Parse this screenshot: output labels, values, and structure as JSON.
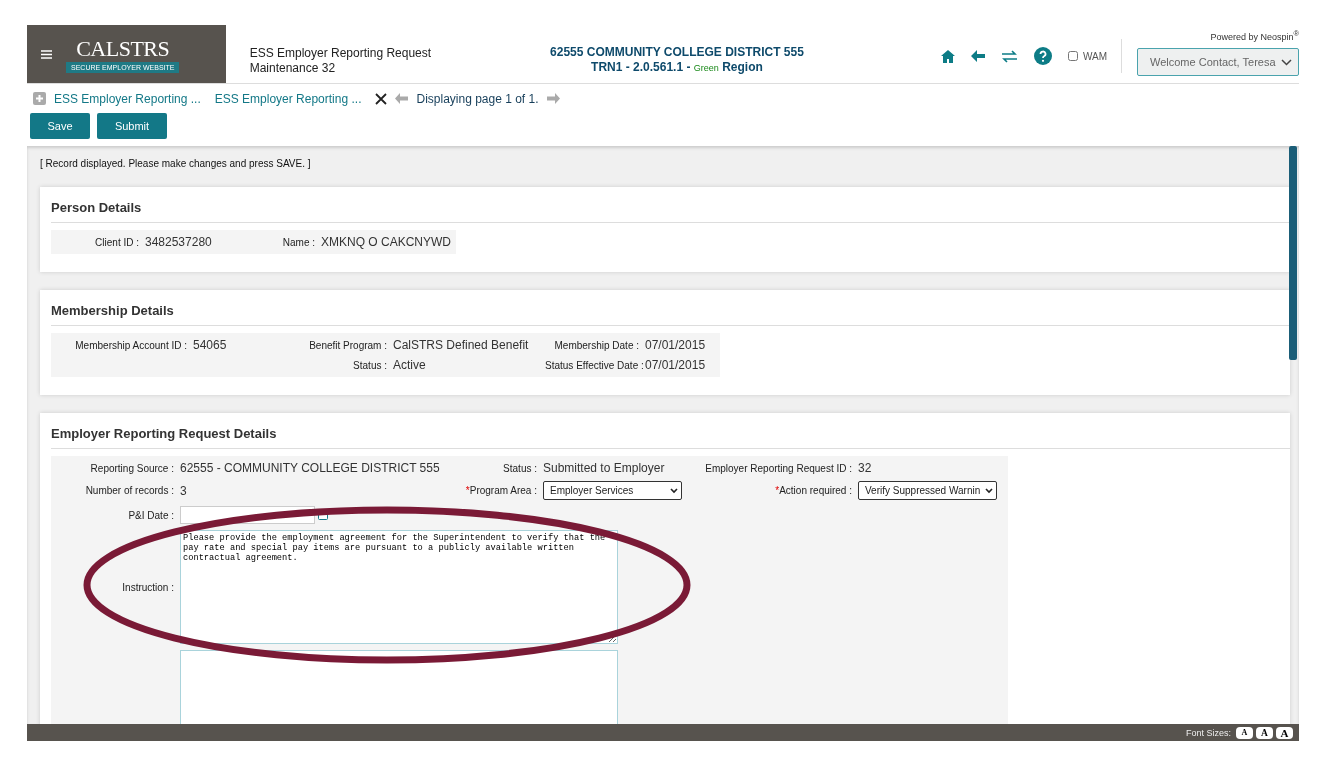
{
  "header": {
    "logo": {
      "title": "CALSTRS",
      "subtitle": "SECURE EMPLOYER WEBSITE"
    },
    "page_title": [
      "ESS Employer Reporting Request",
      "Maintenance 32"
    ],
    "organization": "62555 COMMUNITY COLLEGE DISTRICT 555",
    "version": "TRN1 - 2.0.561.1 -",
    "region_color_name": "Green",
    "region": "Region",
    "wam": {
      "label": "WAM",
      "checked": false
    },
    "powered_by": "Powered by Neospin$^{®}$",
    "user_menu": "Welcome Contact, Teresa"
  },
  "breadcrumbs": {
    "tabs": [
      {
        "label": "ESS Employer Reporting ..."
      },
      {
        "label": "ESS Employer Reporting ..."
      }
    ],
    "paging": "Displaying page 1 of 1."
  },
  "buttons": [
    "Save",
    "Submit"
  ],
  "message": "[ Record displayed. Please make changes and press SAVE. ]",
  "sections": [
    {
      "kind": "person",
      "title": "Person Details",
      "rows": [
        [
          {
            "label": "Client ID :",
            "value": "3482537280"
          },
          {
            "label": "Name :",
            "value": "XMKNQ O CAKCNYWD"
          }
        ]
      ]
    },
    {
      "kind": "membership",
      "title": "Membership Details",
      "rows": [
        [
          {
            "label": "Membership Account ID :",
            "value": "54065"
          },
          {
            "label": "Benefit Program :",
            "value": "CalSTRS Defined Benefit"
          },
          {
            "label": "Membership Date :",
            "value": "07/01/2015"
          }
        ],
        [
          "",
          {
            "label": "Status :",
            "value": "Active"
          },
          {
            "label": "Status Effective Date :",
            "value": "07/01/2015"
          }
        ]
      ]
    },
    {
      "kind": "employer",
      "title": "Employer Reporting Request Details",
      "rows": [
        [
          {
            "label": "Reporting Source :",
            "value": "62555 - COMMUNITY COLLEGE DISTRICT 555"
          },
          {
            "label": "Status :",
            "value": "Submitted to Employer"
          },
          {
            "label": "Employer Reporting Request ID :",
            "value": "32"
          }
        ],
        [
          {
            "label": "Number of records :",
            "value": "3"
          },
          {
            "kind": "select",
            "required_mark": "*",
            "label": "Program Area :",
            "value": "Employer Services"
          },
          {
            "kind": "select",
            "required_mark": "*",
            "label": "Action required :",
            "value": "Verify Suppressed Warnin"
          }
        ],
        [
          {
            "kind": "date",
            "label": "P&I Date :"
          }
        ],
        [
          {
            "kind": "textarea",
            "label": "Instruction :",
            "value": "Please provide the employment agreement for the Superintendent to verify that the pay rate and special pay items are pursuant to a publicly available written contractual agreement."
          }
        ],
        [
          {
            "kind": "textarea"
          }
        ]
      ]
    }
  ],
  "footer": {
    "label": "Font Sizes:",
    "sizes": [
      "A",
      "A",
      "A"
    ]
  }
}
